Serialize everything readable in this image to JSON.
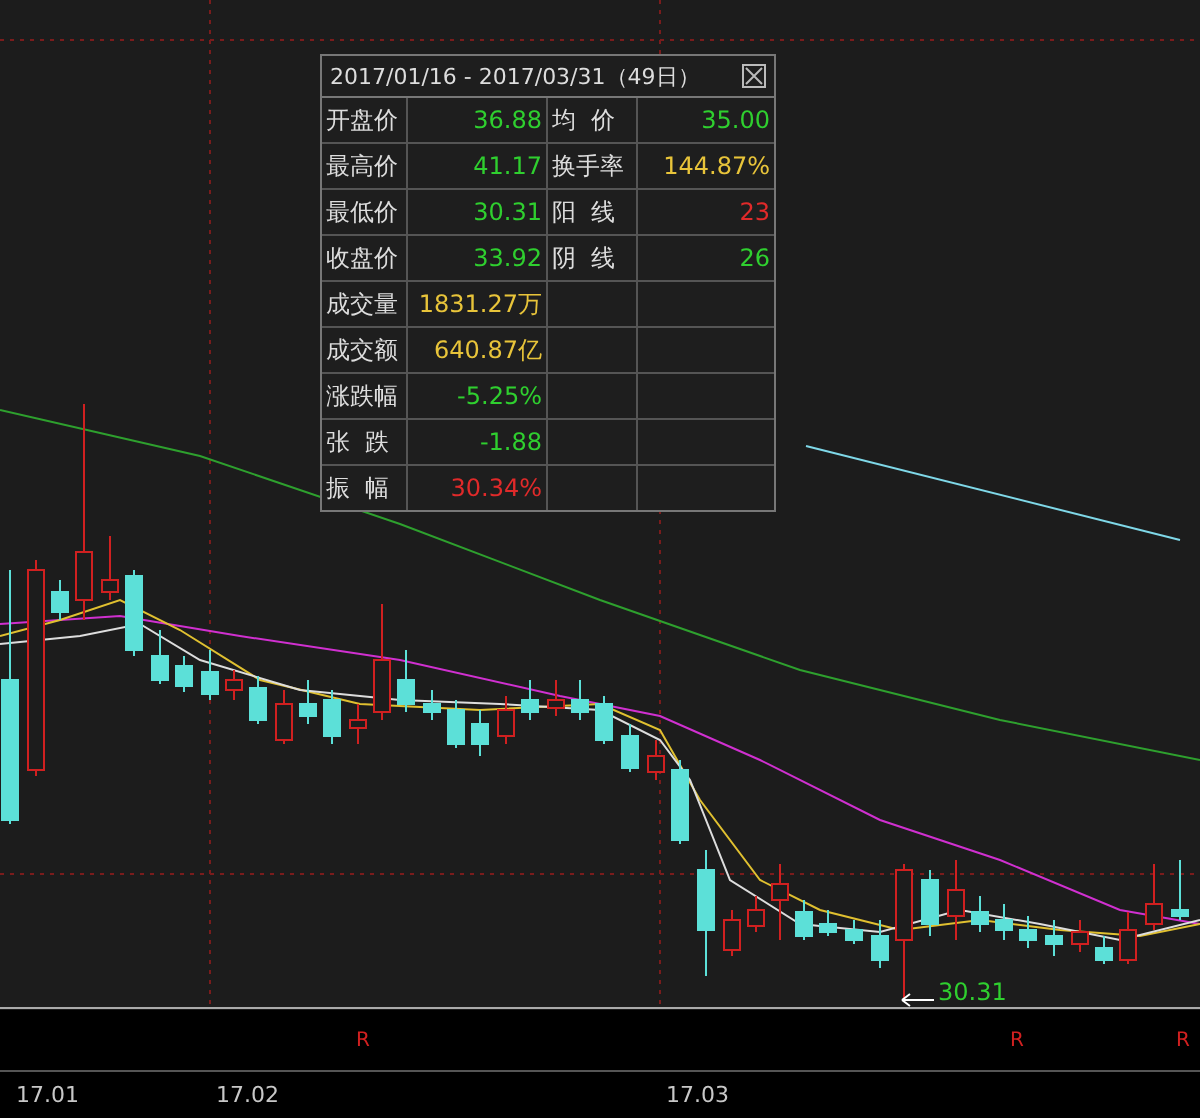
{
  "popup": {
    "title": "2017/01/16 - 2017/03/31（49日）",
    "rows": [
      {
        "left": {
          "label": "开盘价",
          "value": "36.88",
          "color": "#2fcf2f"
        },
        "right": {
          "label": "均  价",
          "value": "35.00",
          "color": "#2fcf2f"
        }
      },
      {
        "left": {
          "label": "最高价",
          "value": "41.17",
          "color": "#2fcf2f"
        },
        "right": {
          "label": "换手率",
          "value": "144.87%",
          "color": "#e8c43a"
        }
      },
      {
        "left": {
          "label": "最低价",
          "value": "30.31",
          "color": "#2fcf2f"
        },
        "right": {
          "label": "阳  线",
          "value": "23",
          "color": "#e02a2a"
        }
      },
      {
        "left": {
          "label": "收盘价",
          "value": "33.92",
          "color": "#2fcf2f"
        },
        "right": {
          "label": "阴  线",
          "value": "26",
          "color": "#2fcf2f"
        }
      },
      {
        "left": {
          "label": "成交量",
          "value": "1831.27万",
          "color": "#e8c43a"
        }
      },
      {
        "left": {
          "label": "成交额",
          "value": "640.87亿",
          "color": "#e8c43a"
        }
      },
      {
        "left": {
          "label": "涨跌幅",
          "value": "-5.25%",
          "color": "#2fcf2f"
        }
      },
      {
        "left": {
          "label": "张  跌",
          "value": "-1.88",
          "color": "#2fcf2f"
        }
      },
      {
        "left": {
          "label": "振  幅",
          "value": "30.34%",
          "color": "#e02a2a"
        }
      }
    ]
  },
  "low_marker": "30.31",
  "r_marks": [
    "R",
    "R",
    "R"
  ],
  "x_labels": [
    "17.01",
    "17.02",
    "17.03"
  ]
}
